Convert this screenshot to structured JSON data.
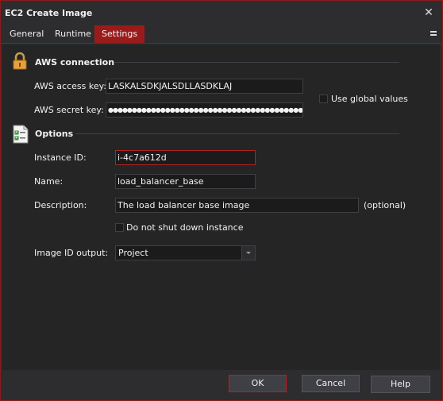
{
  "window": {
    "title": "EC2 Create Image"
  },
  "tabs": [
    {
      "label": "General"
    },
    {
      "label": "Runtime"
    },
    {
      "label": "Settings"
    }
  ],
  "aws_connection": {
    "title": "AWS connection",
    "access_key_label": "AWS access key:",
    "access_key_value": "LASKALSDKJALSDLLASDKLAJ",
    "secret_key_label": "AWS secret key:",
    "secret_key_value": "●●●●●●●●●●●●●●●●●●●●●●●●●●●●●●●●●●●●●●●●●●●●●●●●",
    "use_global_label": "Use global values"
  },
  "options": {
    "title": "Options",
    "instance_id_label": "Instance ID:",
    "instance_id_value": "i-4c7a612d",
    "name_label": "Name:",
    "name_value": "load_balancer_base",
    "description_label": "Description:",
    "description_value": "The load balancer base image",
    "optional_label": "(optional)",
    "no_shutdown_label": "Do not shut down instance",
    "image_id_output_label": "Image ID output:",
    "image_id_output_value": "Project"
  },
  "footer": {
    "ok_label": "OK",
    "cancel_label": "Cancel",
    "help_label": "Help"
  },
  "colors": {
    "accent": "#9b1b1b",
    "background": "#2d2d30",
    "panel": "#252526"
  }
}
